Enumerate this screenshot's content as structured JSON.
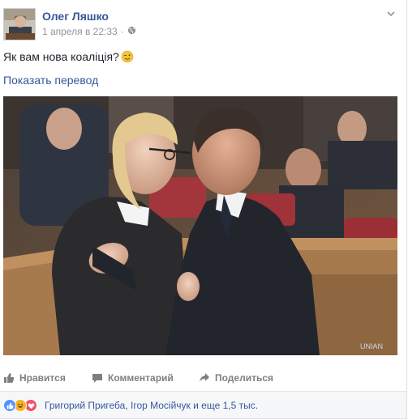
{
  "post": {
    "author": "Олег Ляшко",
    "timestamp": "1 апреля в 22:33",
    "separator": "·",
    "audience_icon": "globe-icon",
    "text": "Як вам нова коаліція?",
    "emoji": "wink-emoji",
    "translate_link": "Показать перевод",
    "photo_watermark": "UNIAN"
  },
  "actions": {
    "like": "Нравится",
    "comment": "Комментарий",
    "share": "Поделиться"
  },
  "reactions": {
    "icons": [
      "like-reaction-icon",
      "haha-reaction-icon",
      "love-reaction-icon"
    ],
    "summary": "Григорий Пригеба, Ігор Мосійчук и еще 1,5 тыс."
  },
  "colors": {
    "link": "#365899",
    "secondary": "#90949c",
    "like": "#5890ff",
    "haha": "#f7b125",
    "love": "#f25268"
  }
}
